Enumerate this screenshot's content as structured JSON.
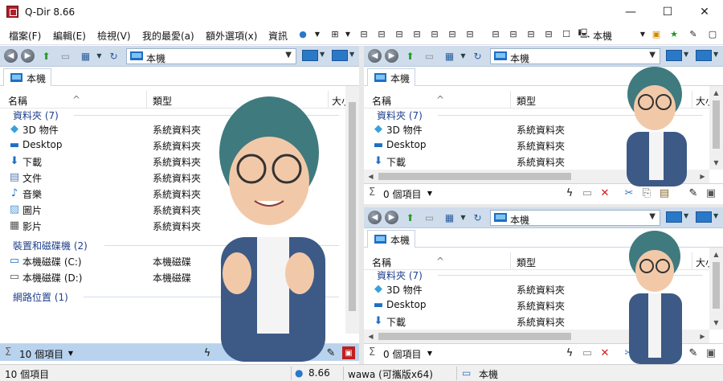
{
  "window": {
    "title": "Q-Dir 8.66",
    "minimize": "—",
    "maximize": "☐",
    "close": "✕"
  },
  "menu": [
    "檔案(F)",
    "編輯(E)",
    "檢視(V)",
    "我的最愛(a)",
    "額外選項(x)",
    "資訊"
  ],
  "toolbar": {
    "location_label": "本機"
  },
  "columns": {
    "name": "名稱",
    "type": "類型",
    "size": "大小"
  },
  "left_pane": {
    "address": "本機",
    "tab": "本機",
    "groups": {
      "folders": "資料夾 (7)",
      "drives": "裝置和磁碟機 (2)",
      "network": "網路位置 (1)"
    },
    "folders": [
      {
        "name": "3D 物件",
        "type": "系統資料夾",
        "icon": "3d-objects-icon"
      },
      {
        "name": "Desktop",
        "type": "系統資料夾",
        "icon": "desktop-icon"
      },
      {
        "name": "下載",
        "type": "系統資料夾",
        "icon": "download-icon"
      },
      {
        "name": "文件",
        "type": "系統資料夾",
        "icon": "document-icon"
      },
      {
        "name": "音樂",
        "type": "系統資料夾",
        "icon": "music-icon"
      },
      {
        "name": "圖片",
        "type": "系統資料夾",
        "icon": "picture-icon"
      },
      {
        "name": "影片",
        "type": "系統資料夾",
        "icon": "video-icon"
      }
    ],
    "drives": [
      {
        "name": "本機磁碟 (C:)",
        "type": "本機磁碟",
        "icon": "windows-drive-icon"
      },
      {
        "name": "本機磁碟 (D:)",
        "type": "本機磁碟",
        "icon": "drive-icon"
      }
    ],
    "status": "10 個項目"
  },
  "right_top_pane": {
    "address": "本機",
    "tab": "本機",
    "group": "資料夾 (7)",
    "rows": [
      {
        "name": "3D 物件",
        "type": "系統資料夾"
      },
      {
        "name": "Desktop",
        "type": "系統資料夾"
      },
      {
        "name": "下載",
        "type": "系統資料夾"
      }
    ],
    "status": "0 個項目"
  },
  "right_bottom_pane": {
    "address": "本機",
    "tab": "本機",
    "group": "資料夾 (7)",
    "rows": [
      {
        "name": "3D 物件",
        "type": "系統資料夾"
      },
      {
        "name": "Desktop",
        "type": "系統資料夾"
      },
      {
        "name": "下載",
        "type": "系統資料夾"
      }
    ],
    "status": "0 個項目"
  },
  "bottom_status": {
    "items": "10 個項目",
    "version": "8.66",
    "user": "wawa (可攜版x64)",
    "location": "本機"
  },
  "colors": {
    "accent": "#2a78c8",
    "pane_toolbar": "#cfdcec",
    "active_status": "#b9d3ee",
    "group_text": "#1e3f8a"
  }
}
